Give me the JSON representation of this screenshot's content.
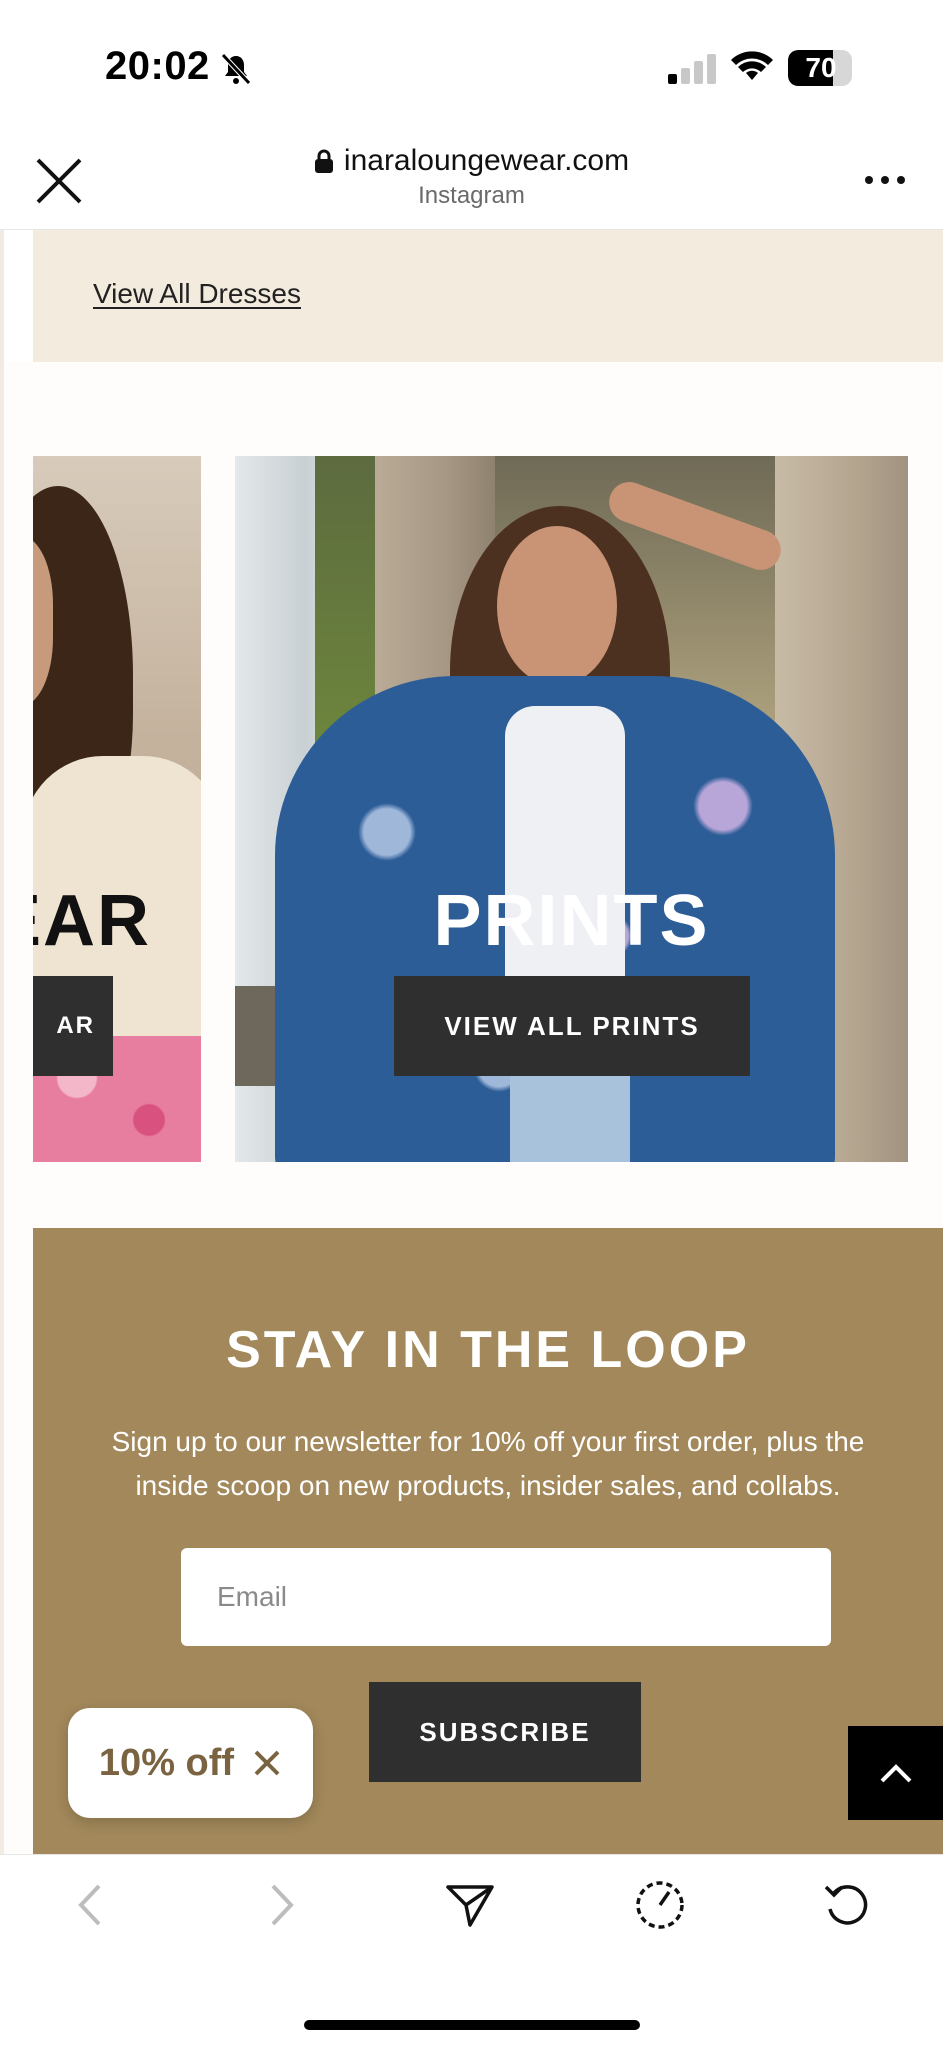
{
  "status_bar": {
    "time": "20:02",
    "battery": "70",
    "battery_level": 0.7,
    "icons": [
      "bell-slash-icon",
      "cellular-signal-icon",
      "wifi-icon",
      "battery-icon"
    ]
  },
  "browser": {
    "url": "inaraloungewear.com",
    "source": "Instagram",
    "icons": [
      "close-icon",
      "lock-icon",
      "more-icon"
    ]
  },
  "dresses": {
    "link_label": "View All Dresses"
  },
  "categories": [
    {
      "title": "EAR",
      "button": "AR"
    },
    {
      "title": "PRINTS",
      "button": "VIEW ALL PRINTS"
    }
  ],
  "newsletter": {
    "title": "STAY IN THE LOOP",
    "text": "Sign up to our newsletter for 10% off your first order, plus the inside scoop on new products, insider sales, and collabs.",
    "email_placeholder": "Email",
    "subscribe_label": "SUBSCRIBE"
  },
  "discount": {
    "label": "10% off"
  },
  "toolbar": {
    "icons": [
      "back-icon",
      "forward-icon",
      "share-icon",
      "speed-icon",
      "reload-icon"
    ]
  },
  "colors": {
    "newsletter_bg": "#a2885a",
    "dresses_strip_bg": "#f3ebdd",
    "button_dark": "#2f2f2f",
    "discount_text": "#7a6340"
  }
}
